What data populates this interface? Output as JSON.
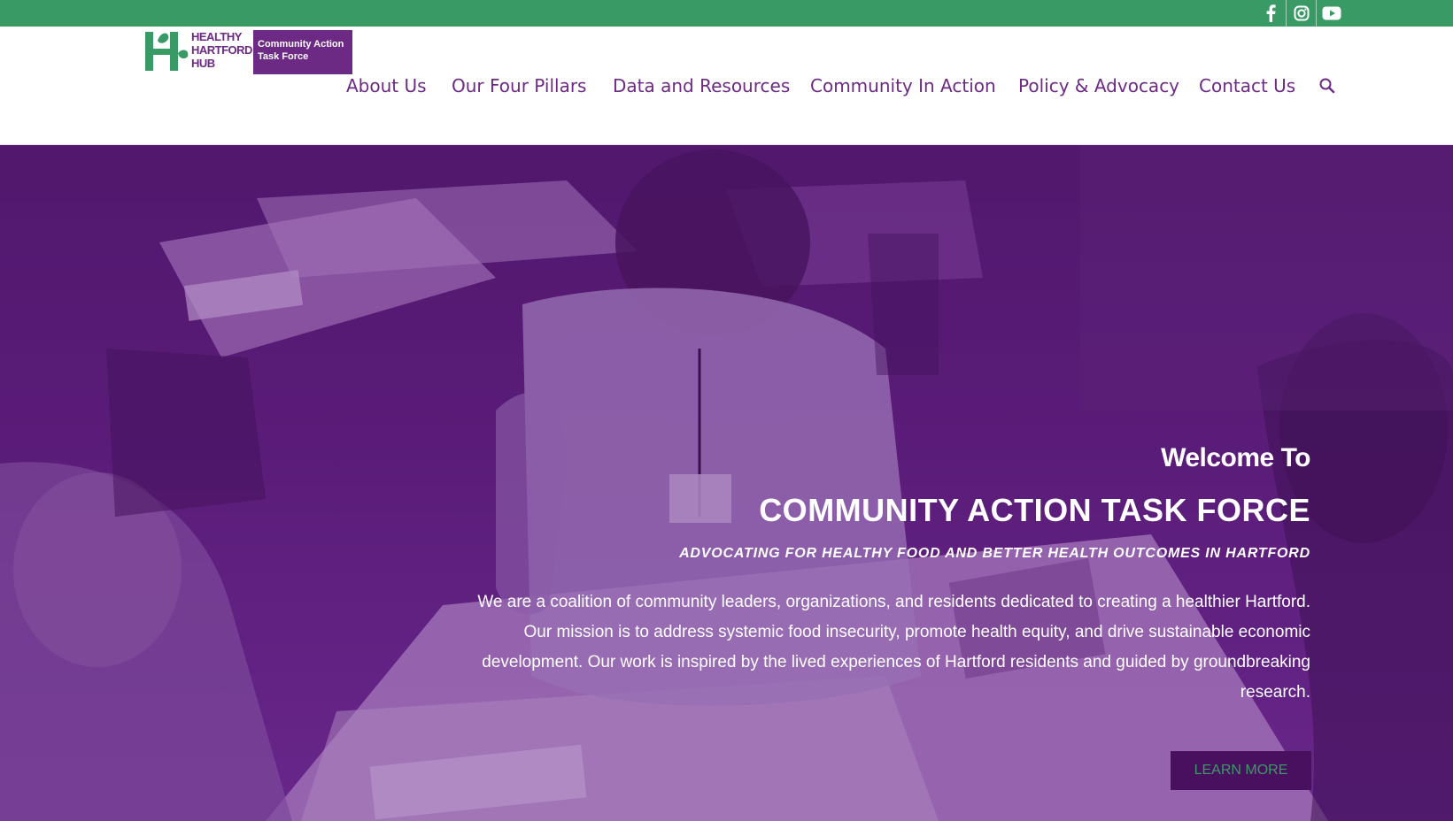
{
  "social": {
    "facebook": "facebook-icon",
    "instagram": "instagram-icon",
    "youtube": "youtube-icon"
  },
  "logo": {
    "hub_text": "HEALTHY HARTFORD HUB",
    "box_line1": "Community Action",
    "box_line2": "Task Force"
  },
  "nav": {
    "items": [
      "About Us",
      "Our Four Pillars",
      "Data and Resources",
      "Community In Action",
      "Policy & Advocacy",
      "Contact Us"
    ],
    "search_icon": "search-icon"
  },
  "hero": {
    "welcome": "Welcome To",
    "title": "COMMUNITY ACTION TASK FORCE",
    "tagline": "ADVOCATING FOR HEALTHY FOOD AND BETTER HEALTH OUTCOMES IN HARTFORD",
    "description": "We are a coalition of community leaders, organizations, and residents dedicated to creating a healthier Hartford. Our mission is to address systemic food insecurity, promote health equity, and drive sustainable economic development. Our work is inspired by the lived experiences of Hartford residents and guided by groundbreaking research.",
    "button_label": "LEARN MORE"
  },
  "colors": {
    "brand_green": "#3a9a66",
    "brand_purple": "#6d2a85",
    "button_bg": "#4a1060"
  }
}
